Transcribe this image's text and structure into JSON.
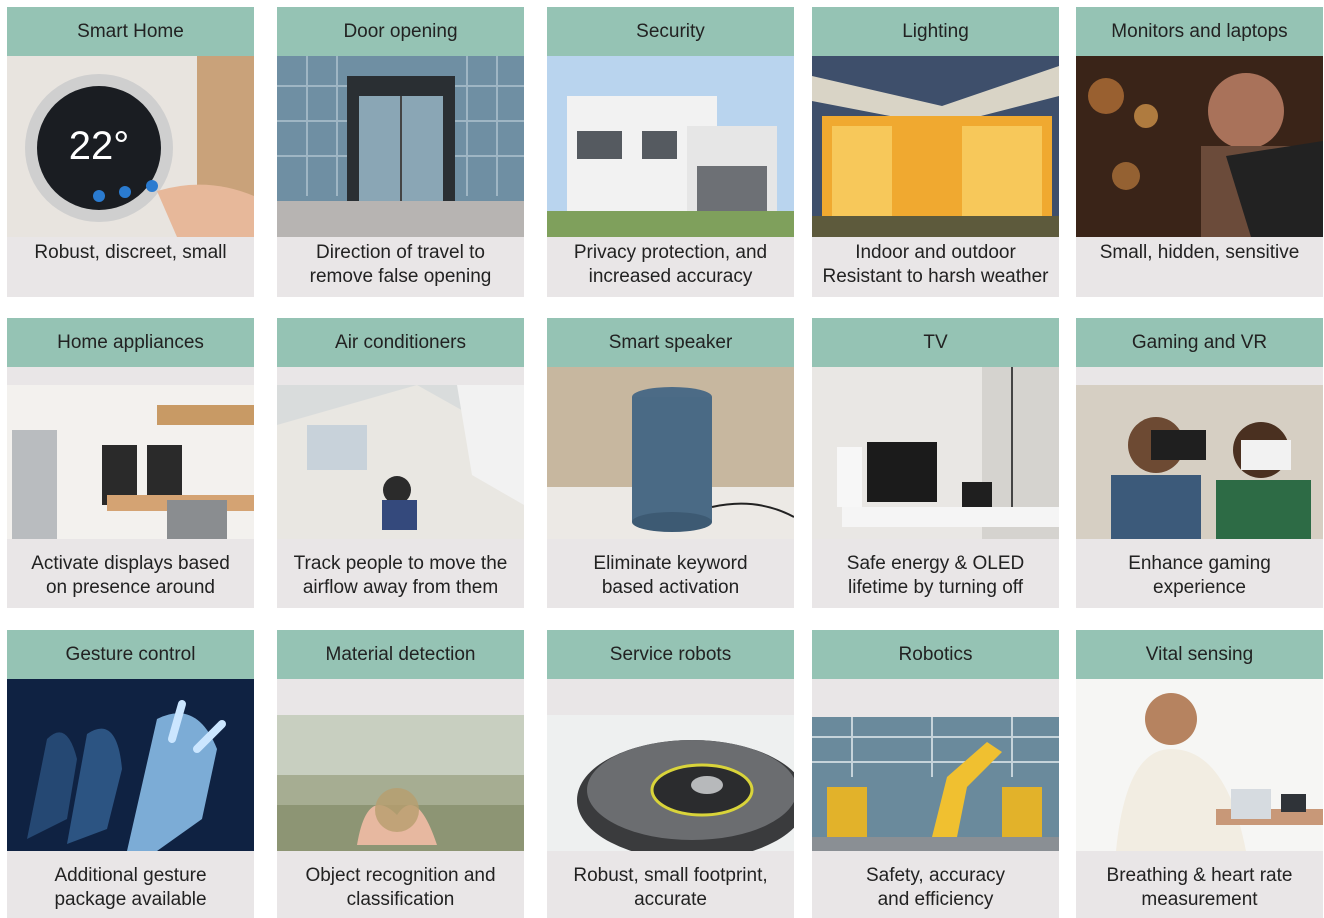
{
  "cards": [
    {
      "title": "Smart Home",
      "caption": "Robust, discreet, small",
      "image": "thermostat-photo"
    },
    {
      "title": "Door opening",
      "caption": "Direction of travel to\nremove false opening",
      "image": "glass-door-photo"
    },
    {
      "title": "Security",
      "caption": "Privacy protection, and\nincreased accuracy",
      "image": "modern-house-photo"
    },
    {
      "title": "Lighting",
      "caption": "Indoor and outdoor\nResistant to harsh weather",
      "image": "lit-house-photo"
    },
    {
      "title": "Monitors and laptops",
      "caption": "Small, hidden, sensitive",
      "image": "man-with-tablet-photo"
    },
    {
      "title": "Home appliances",
      "caption": "Activate displays based\non presence around",
      "image": "kitchen-photo"
    },
    {
      "title": "Air conditioners",
      "caption": "Track people to move the\nairflow away from them",
      "image": "office-ac-photo"
    },
    {
      "title": "Smart speaker",
      "caption": "Eliminate keyword\nbased activation",
      "image": "smart-speaker-photo"
    },
    {
      "title": "TV",
      "caption": "Safe energy & OLED\nlifetime by turning off",
      "image": "tv-room-photo"
    },
    {
      "title": "Gaming and VR",
      "caption": "Enhance gaming\nexperience",
      "image": "vr-headsets-photo"
    },
    {
      "title": "Gesture control",
      "caption": "Additional gesture\npackage available",
      "image": "gesture-hand-photo"
    },
    {
      "title": "Material detection",
      "caption": "Object recognition and\nclassification",
      "image": "hands-in-grain-photo"
    },
    {
      "title": "Service robots",
      "caption": "Robust, small footprint,\naccurate",
      "image": "robot-vacuum-photo"
    },
    {
      "title": "Robotics",
      "caption": "Safety, accuracy\nand efficiency",
      "image": "industrial-robots-photo"
    },
    {
      "title": "Vital sensing",
      "caption": "Breathing & heart rate\nmeasurement",
      "image": "blood-pressure-photo"
    }
  ]
}
